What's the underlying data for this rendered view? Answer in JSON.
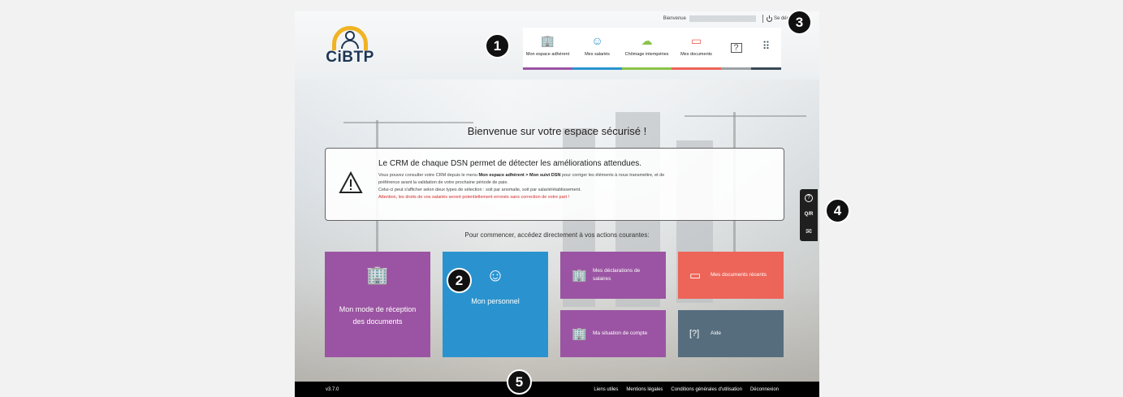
{
  "header": {
    "logo_text": "CiBTP",
    "welcome": "Bienvenue",
    "logout": "Se déconnecter"
  },
  "nav": [
    {
      "label": "Mon espace adhérent",
      "icon": "building-icon",
      "color": "#9b54a3"
    },
    {
      "label": "Mes salariés",
      "icon": "users-icon",
      "color": "#2a93cf"
    },
    {
      "label": "Chômage intempéries",
      "icon": "weather-icon",
      "color": "#8bc34a"
    },
    {
      "label": "Mes documents",
      "icon": "folder-icon",
      "color": "#ed6458"
    },
    {
      "label": "",
      "icon": "help-icon",
      "color": "#9aa1a6"
    },
    {
      "label": "",
      "icon": "apps-grid-icon",
      "color": "#3a4a56"
    }
  ],
  "main": {
    "banner": "Bienvenue sur votre espace sécurisé !",
    "alert": {
      "title": "Le CRM de chaque DSN permet de détecter les améliorations attendues.",
      "line1_a": "Vous pouvez consulter votre CRM depuis le menu ",
      "line1_b": "Mon espace adhérent > Mon suivi DSN",
      "line1_c": " pour corriger les éléments à nous transmettre, et de",
      "line2": "préférence avant la validation de votre prochaine période de paie.",
      "line3": "Celui-ci peut s'afficher selon deux types de sélection : soit par anomalie, soit par salarié/établissement.",
      "line4": "Attention, les droits de vos salariés seront potentiellement erronés sans correction de votre part !"
    },
    "subtitle": "Pour commencer, accédez directement à vos actions courantes:",
    "tiles": {
      "reception": "Mon mode de réception des documents",
      "personnel": "Mon personnel",
      "declarations": "Mes déclarations de salaires",
      "documents": "Mes documents récents",
      "situation": "Ma situation de compte",
      "aide": "Aide"
    }
  },
  "side": {
    "help": "?",
    "qr": "Q/R",
    "mail": "✉"
  },
  "footer": {
    "version": "v3.7.0",
    "links": [
      "Liens utiles",
      "Mentions légales",
      "Conditions générales d'utilisation",
      "Déconnexion"
    ]
  },
  "badges": [
    "1",
    "2",
    "3",
    "4",
    "5"
  ]
}
